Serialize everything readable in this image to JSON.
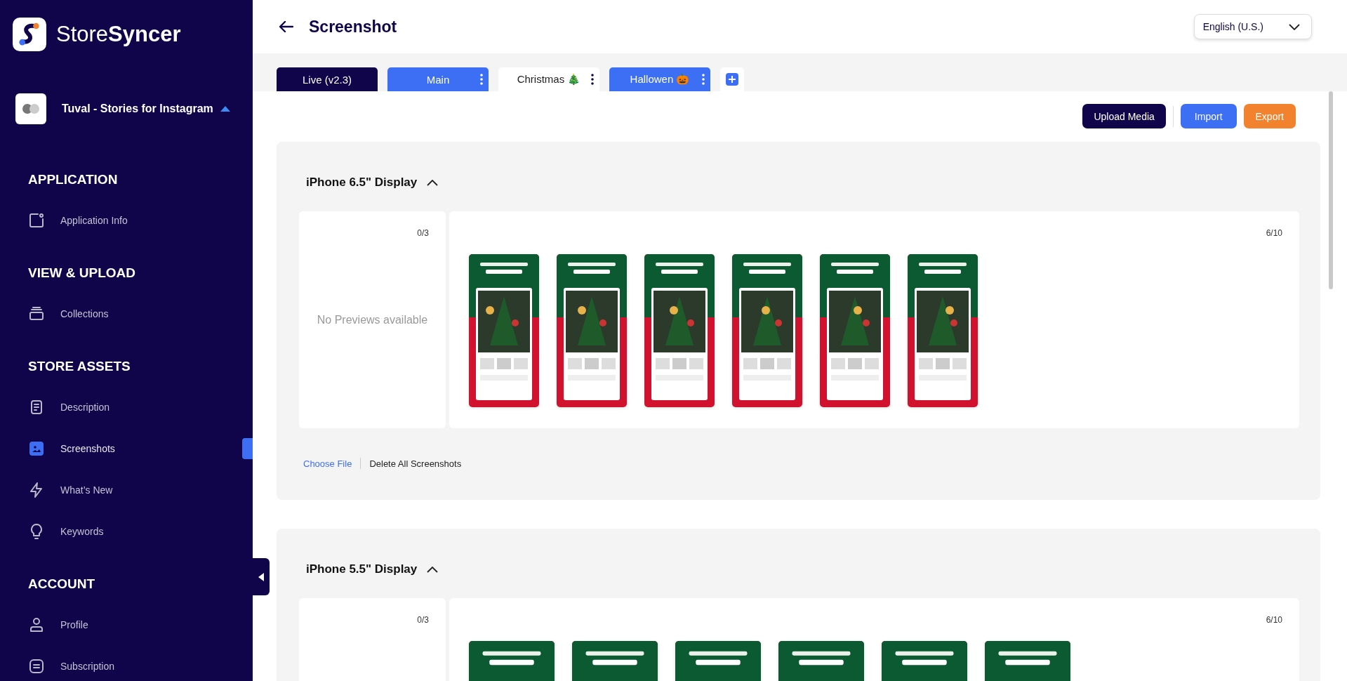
{
  "sidebar": {
    "brand": "Store**Syncer**",
    "app_name": "Tuval - Stories for Instagram",
    "sections": [
      {
        "title": "APPLICATION",
        "items": [
          {
            "label": "Application Info",
            "selected": false
          }
        ]
      },
      {
        "title": "VIEW & UPLOAD",
        "items": [
          {
            "label": "Collections",
            "selected": false
          }
        ]
      },
      {
        "title": "STORE ASSETS",
        "items": [
          {
            "label": "Description",
            "selected": false
          },
          {
            "label": "Screenshots",
            "selected": true
          },
          {
            "label": "What’s New",
            "selected": false
          },
          {
            "label": "Keywords",
            "selected": false
          }
        ]
      },
      {
        "title": "ACCOUNT",
        "items": [
          {
            "label": "Profile",
            "selected": false
          },
          {
            "label": "Subscription",
            "selected": false
          }
        ]
      }
    ]
  },
  "header": {
    "title": "Screenshot",
    "language": "English (U.S.)"
  },
  "tabs": [
    {
      "label": "Live (v2.3)",
      "kind": "live",
      "selected": false
    },
    {
      "label": "Main",
      "kind": "draft",
      "selected": false
    },
    {
      "label": "Christmas 🎄",
      "kind": "draft",
      "selected": true
    },
    {
      "label": "Hallowen 🎃",
      "kind": "draft",
      "selected": false
    }
  ],
  "toolbar": [
    {
      "label": "Upload Media",
      "kind": "primary"
    },
    {
      "label": "Import",
      "kind": "secondary"
    },
    {
      "label": "Export",
      "kind": "accent"
    }
  ],
  "displays": [
    {
      "title": "iPhone 6.5\" Display",
      "expanded": true,
      "preview_count": "0/3",
      "preview_empty": "No Previews available",
      "screenshot_count": "6/10",
      "screenshots": [
        {
          "kind": "picture"
        },
        {
          "kind": "picture"
        },
        {
          "kind": "picture"
        },
        {
          "kind": "picture"
        },
        {
          "kind": "picture"
        },
        {
          "kind": "picture"
        }
      ],
      "actions": [
        {
          "label": "Choose File",
          "kind": "link"
        },
        {
          "label": "Delete All Screenshots",
          "kind": "plain"
        }
      ]
    },
    {
      "title": "iPhone 5.5\" Display",
      "expanded": true,
      "preview_count": "0/3",
      "screenshot_count": "6/10",
      "screenshots": [
        {
          "kind": "picture"
        },
        {
          "kind": "picture"
        },
        {
          "kind": "picture"
        },
        {
          "kind": "picture"
        },
        {
          "kind": "picture"
        },
        {
          "kind": "picture"
        }
      ]
    }
  ]
}
